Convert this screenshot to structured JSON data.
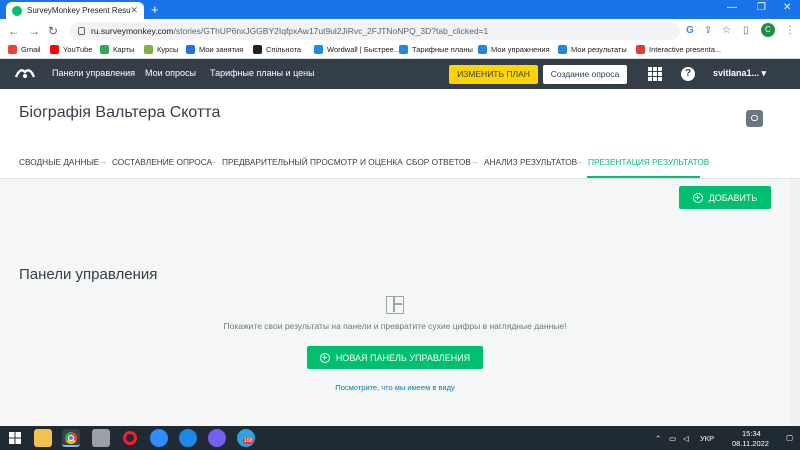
{
  "browser": {
    "tab_title": "SurveyMonkey Present Results",
    "tab_close": "✕",
    "new_tab": "+",
    "url_host": "ru.surveymonkey.com",
    "url_path": "/stories/GThUP6nxJGGBY2IqfpxAw17ut9ul2JiRvc_2FJTNoNPQ_3D?tab_clicked=1",
    "avatar_letter": "C",
    "bookmarks": [
      "Gmail",
      "YouTube",
      "Карты",
      "Курсы",
      "Мои занятия",
      "Спільнота",
      "Wordwall | Быстрее...",
      "Тарифные планы",
      "Мои упражнения",
      "Мои результаты",
      "Interactive presenta..."
    ],
    "bookmark_colors": [
      "#ea4335",
      "#ff0000",
      "#34a853",
      "#7cb342",
      "#1a73e8",
      "#202124",
      "#1e88e5",
      "#1e88e5",
      "#1e88e5",
      "#1e88e5",
      "#e53935"
    ]
  },
  "header": {
    "nav": [
      "Панели управления",
      "Мои опросы",
      "Тарифные планы и цены"
    ],
    "upgrade_label": "ИЗМЕНИТЬ ПЛАН",
    "create_label": "Создание опроса",
    "help_glyph": "?",
    "user_name": "svitlana1...",
    "user_caret": "▾"
  },
  "survey": {
    "title": "Біографія Вальтера Скотта"
  },
  "steps": [
    "СВОДНЫЕ ДАННЫЕ",
    "СОСТАВЛЕНИЕ ОПРОСА",
    "ПРЕДВАРИТЕЛЬНЫЙ ПРОСМОТР И ОЦЕНКА",
    "СБОР ОТВЕТОВ",
    "АНАЛИЗ РЕЗУЛЬТАТОВ",
    "ПРЕЗЕНТАЦИЯ РЕЗУЛЬТАТОВ"
  ],
  "step_arrow": "→",
  "main": {
    "add_label": "ДОБАВИТЬ",
    "section_title": "Панели управления",
    "description": "Покажите свои результаты на панели и превратите сухие цифры в наглядные данные!",
    "new_dashboard_label": "НОВАЯ ПАНЕЛЬ УПРАВЛЕНИЯ",
    "see_link": "Посмотрите, что мы имеем в виду"
  },
  "taskbar": {
    "language": "УКР",
    "time": "15:34",
    "date": "08.11.2022",
    "badge": "168"
  },
  "colors": {
    "brand_green": "#00bf6f",
    "header_dark": "#333e48",
    "upgrade_yellow": "#ffd400",
    "chrome_blue": "#1a73e8"
  }
}
